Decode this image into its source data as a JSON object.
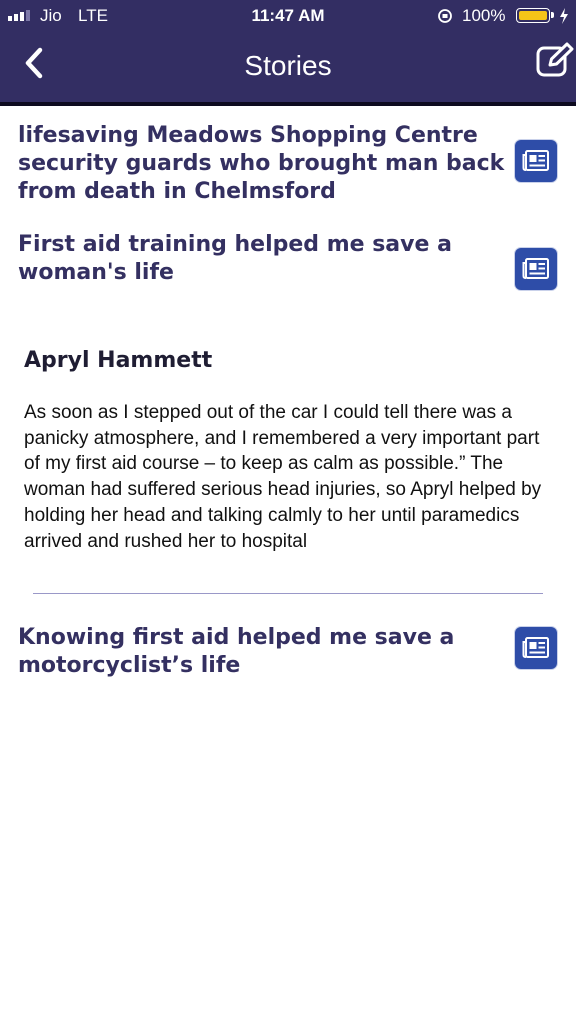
{
  "status_bar": {
    "carrier": "Jio",
    "network": "LTE",
    "time": "11:47 AM",
    "battery_percent": "100%",
    "battery_level": 1.0,
    "battery_color": "#f5c518"
  },
  "nav": {
    "title": "Stories",
    "back_icon": "chevron-left-icon",
    "edit_icon": "compose-icon",
    "bar_color": "#332e63"
  },
  "stories": [
    {
      "title": "lifesaving Meadows Shopping Centre security guards who brought man back from death in Chelmsford",
      "icon": "newspaper-icon"
    },
    {
      "title": "First aid training helped me save a woman's life",
      "icon": "newspaper-icon"
    },
    {
      "title": "Knowing first aid helped me save a motorcyclist’s life",
      "icon": "newspaper-icon"
    }
  ],
  "expanded_story": {
    "author": "Apryl Hammett",
    "body": "As soon as I stepped out of the car I could tell there was a panicky atmosphere, and I remembered a very important part of my first aid course – to keep as calm as possible.” The woman had suffered serious head injuries, so Apryl helped by holding her head and talking calmly to her until paramedics arrived and rushed her to hospital"
  },
  "colors": {
    "title_text": "#343061",
    "icon_bg": "#2e4da8"
  }
}
